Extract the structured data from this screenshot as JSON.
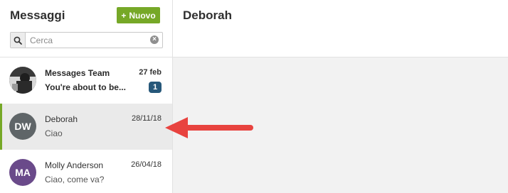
{
  "sidebar": {
    "title": "Messaggi",
    "new_button": {
      "icon": "+",
      "label": "Nuovo"
    },
    "search": {
      "placeholder": "Cerca",
      "value": ""
    },
    "conversations": [
      {
        "name": "Messages Team",
        "date": "27 feb",
        "preview": "You're about to be...",
        "unread": "1",
        "avatar_initials": "",
        "avatar_color": "#2b2b2b"
      },
      {
        "name": "Deborah",
        "date": "28/11/18",
        "preview": "Ciao",
        "unread": "",
        "avatar_initials": "DW",
        "avatar_color": "#5f6568"
      },
      {
        "name": "Molly Anderson",
        "date": "26/04/18",
        "preview": "Ciao, come va?",
        "unread": "",
        "avatar_initials": "MA",
        "avatar_color": "#6a4a8a"
      }
    ]
  },
  "chat": {
    "title": "Deborah"
  },
  "colors": {
    "accent": "#76a827",
    "badge": "#27587a",
    "annotation_arrow": "#e8433f"
  }
}
